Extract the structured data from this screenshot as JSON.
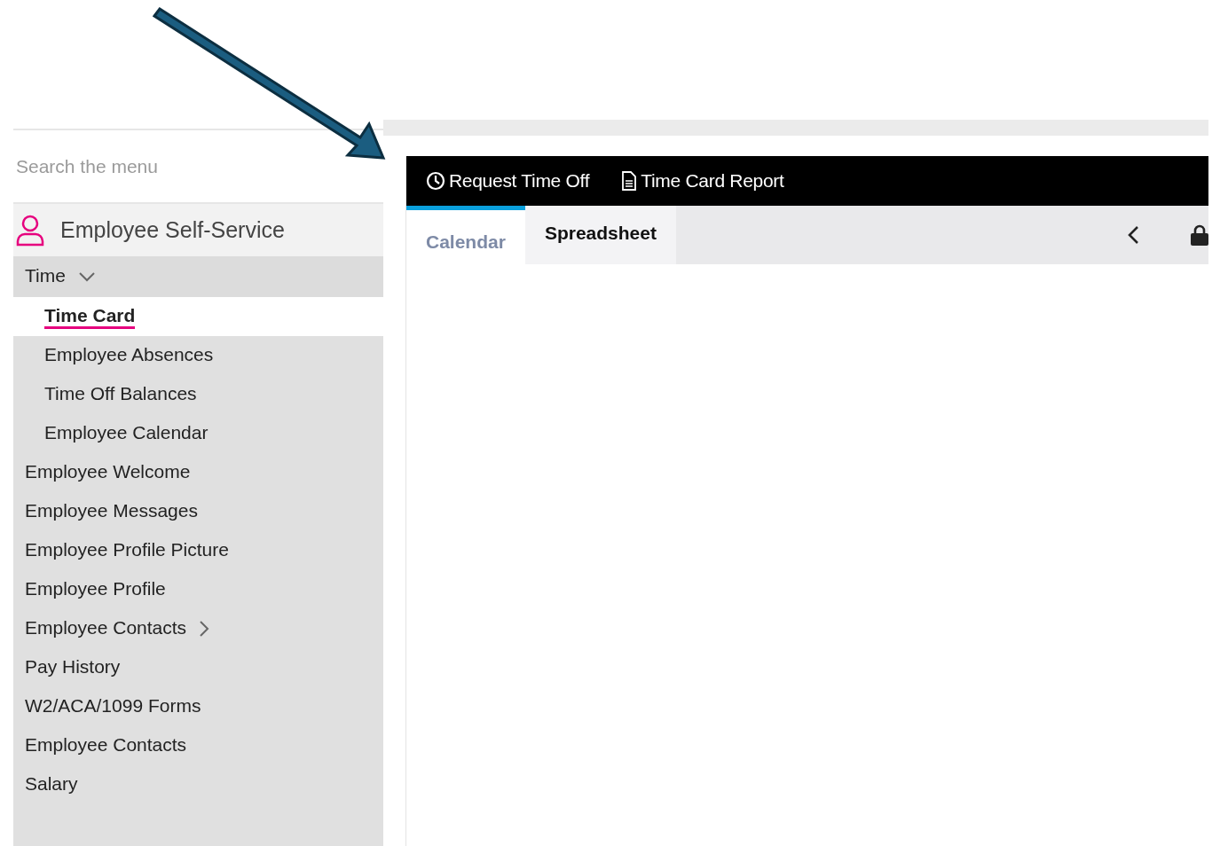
{
  "sidebar": {
    "search": {
      "placeholder": "Search the menu"
    },
    "module": {
      "title": "Employee Self-Service"
    },
    "items": [
      {
        "label": "Time",
        "selected": false,
        "expanded": true,
        "children": [
          {
            "label": "Time Card",
            "selected": true
          },
          {
            "label": "Employee Absences",
            "selected": false
          },
          {
            "label": "Time Off Balances",
            "selected": false
          },
          {
            "label": "Employee Calendar",
            "selected": false
          }
        ]
      },
      {
        "label": "Employee Welcome",
        "selected": false
      },
      {
        "label": "Employee Messages",
        "selected": false
      },
      {
        "label": "Employee Profile Picture",
        "selected": false
      },
      {
        "label": "Employee Profile",
        "selected": false
      },
      {
        "label": "Employee Contacts",
        "selected": false,
        "expanded": false
      },
      {
        "label": "Pay History",
        "selected": false
      },
      {
        "label": "W2/ACA/1099 Forms",
        "selected": false
      },
      {
        "label": "Employee Contacts",
        "selected": false
      },
      {
        "label": "Salary",
        "selected": false
      }
    ]
  },
  "toolbar": {
    "actions": [
      {
        "kind": "clock",
        "label": "Request Time Off"
      },
      {
        "kind": "document",
        "label": "Time Card Report"
      }
    ]
  },
  "tabs": [
    {
      "label": "Calendar",
      "selected": true
    },
    {
      "label": "Spreadsheet",
      "selected": false
    }
  ]
}
